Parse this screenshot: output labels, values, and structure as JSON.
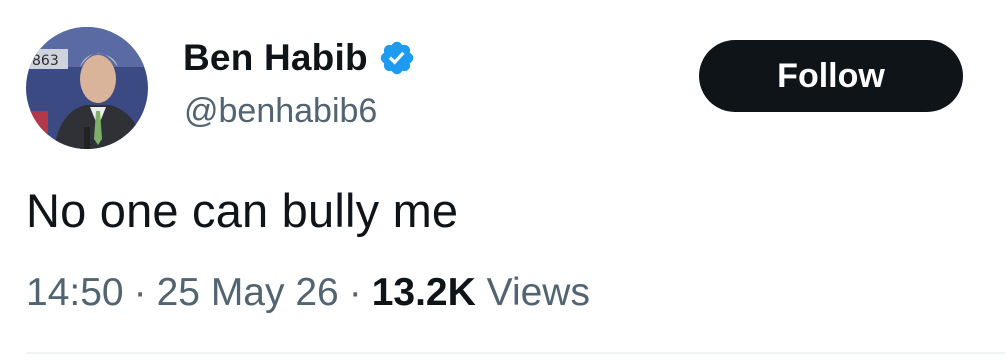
{
  "author": {
    "display_name": "Ben Habib",
    "handle": "@benhabib6",
    "verified": true,
    "avatar_label": "863"
  },
  "follow_button": {
    "label": "Follow"
  },
  "tweet": {
    "text": "No one can bully me"
  },
  "meta": {
    "time": "14:50",
    "date": "25 May 26",
    "separator": "·",
    "views_count": "13.2K",
    "views_label": "Views"
  },
  "icons": {
    "verified": "verified-badge-icon"
  },
  "colors": {
    "primary_text": "#0f1419",
    "secondary_text": "#536471",
    "verified_blue": "#1d9bf0",
    "follow_bg": "#0f1419",
    "divider": "#eff3f4"
  }
}
